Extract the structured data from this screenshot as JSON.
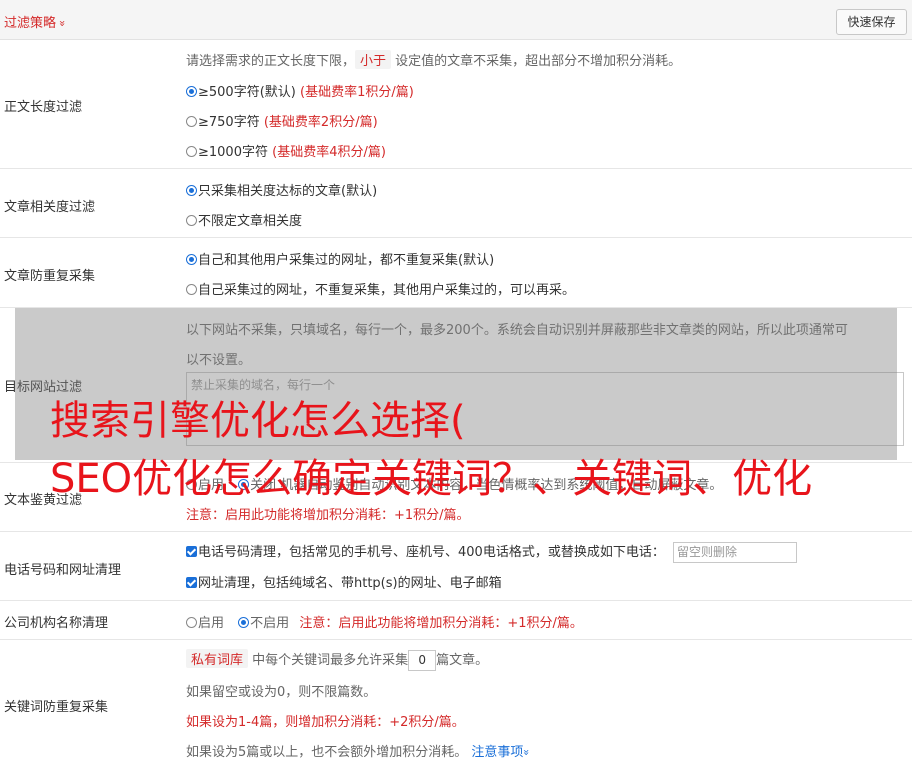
{
  "header": {
    "title": "过滤策略",
    "chevron": "»",
    "save_label": "快速保存"
  },
  "sections": {
    "length": {
      "label": "正文长度过滤",
      "desc_before": "请选择需求的正文长度下限，",
      "desc_pill": "小于",
      "desc_after": "设定值的文章不采集，超出部分不增加积分消耗。",
      "options": [
        {
          "text": "≥500字符(默认)",
          "fee": "(基础费率1积分/篇)",
          "checked": true
        },
        {
          "text": "≥750字符",
          "fee": "(基础费率2积分/篇)",
          "checked": false
        },
        {
          "text": "≥1000字符",
          "fee": "(基础费率4积分/篇)",
          "checked": false
        }
      ]
    },
    "relevance": {
      "label": "文章相关度过滤",
      "options": [
        {
          "text": "只采集相关度达标的文章(默认)",
          "checked": true
        },
        {
          "text": "不限定文章相关度",
          "checked": false
        }
      ]
    },
    "dedupe": {
      "label": "文章防重复采集",
      "options": [
        {
          "text": "自己和其他用户采集过的网址，都不重复采集(默认)",
          "checked": true
        },
        {
          "text": "自己采集过的网址，不重复采集，其他用户采集过的，可以再采。",
          "checked": false
        }
      ]
    },
    "target": {
      "label": "目标网站过滤",
      "desc_line1": "以下网站不采集，只填域名，每行一个，最多200个。系统会自动识别并屏蔽那些非文章类的网站，所以此项通常可",
      "desc_line2": "以不设置。",
      "placeholder": "禁止采集的域名，每行一个"
    },
    "porn": {
      "label": "文本鉴黄过滤",
      "opt_on": "启用",
      "opt_off": "关闭",
      "desc": "机器自动鉴别自动识别文本内容，当色情概率达到系统阈值，自动屏蔽文章。",
      "note": "注意：启用此功能将增加积分消耗：+1积分/篇。"
    },
    "contact": {
      "label": "电话号码和网址清理",
      "phone": "电话号码清理，包括常见的手机号、座机号、400电话格式，或替换成如下电话：",
      "phone_placeholder": "留空则删除",
      "url": "网址清理，包括纯域名、带http(s)的网址、电子邮箱"
    },
    "company": {
      "label": "公司机构名称清理",
      "opt_on": "启用",
      "opt_off": "不启用",
      "note": "注意：启用此功能将增加积分消耗：+1积分/篇。"
    },
    "keyword": {
      "label": "关键词防重复采集",
      "pill": "私有词库",
      "text_before": "中每个关键词最多允许采集",
      "value": "0",
      "text_after": "篇文章。",
      "line2": "如果留空或设为0，则不限篇数。",
      "line3": "如果设为1-4篇，则增加积分消耗：+2积分/篇。",
      "line4": "如果设为5篇或以上，也不会额外增加积分消耗。",
      "notes_link": "注意事项",
      "notes_chevron": "»"
    }
  },
  "overlay": {
    "line1": "搜索引擎优化怎么选择(",
    "line2": "SEO优化怎么确定关键词？、关键词、优化"
  }
}
